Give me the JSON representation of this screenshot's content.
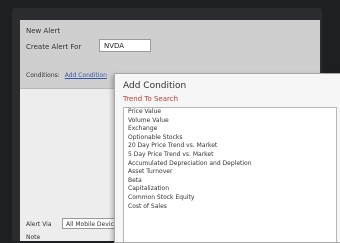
{
  "panel": {
    "title": "New Alert",
    "create_label": "Create Alert For",
    "ticker_value": "NVDA",
    "conditions_label": "Conditions",
    "conditions_link": "Add Condition",
    "alert_via_label": "Alert Via",
    "alert_via_value": "All Mobile Devices",
    "note_label": "Note"
  },
  "popup": {
    "title": "Add Condition",
    "subtitle": "Trend To Search",
    "items": [
      "Price Value",
      "Volume Value",
      "Exchange",
      "Optionable Stocks",
      "20 Day Price Trend vs. Market",
      "5 Day Price Trend vs. Market",
      "Accumulated Depreciation and Depletion",
      "Asset Turnover",
      "Beta",
      "Capitalization",
      "Common Stock Equity",
      "Cost of Sales"
    ]
  }
}
